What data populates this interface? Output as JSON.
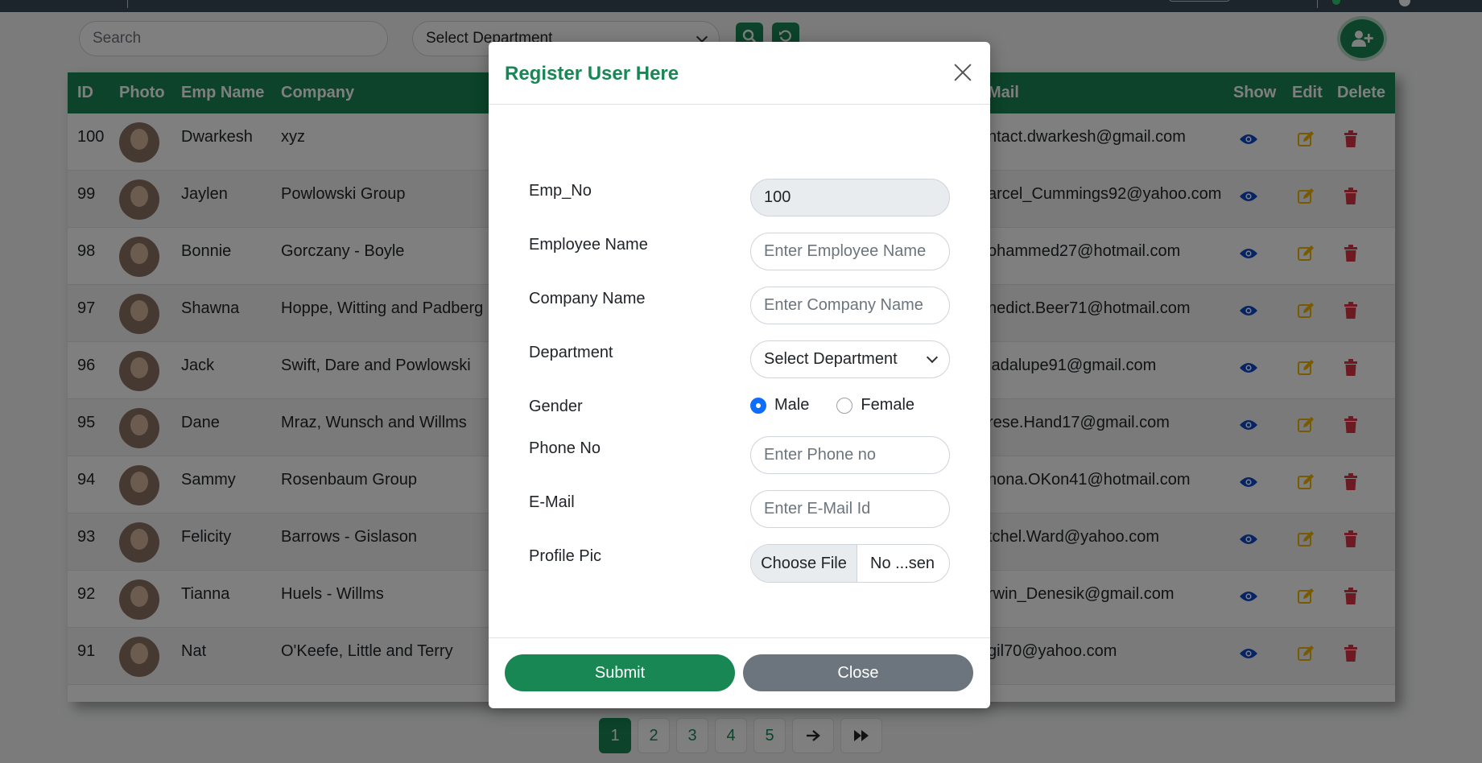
{
  "toolbar": {
    "search_placeholder": "Search",
    "department_select": "Select Department",
    "search_icon": "search-icon",
    "reset_icon": "refresh-icon",
    "add_user_icon": "user-plus-icon"
  },
  "table": {
    "headers": [
      "ID",
      "Photo",
      "Emp Name",
      "Company",
      "Mail",
      "Show",
      "Edit",
      "Delete"
    ],
    "rows": [
      {
        "id": "100",
        "name": "Dwarkesh",
        "company": "xyz",
        "mail": "ntact.dwarkesh@gmail.com"
      },
      {
        "id": "99",
        "name": "Jaylen",
        "company": "Powlowski Group",
        "mail": "arcel_Cummings92@yahoo.com"
      },
      {
        "id": "98",
        "name": "Bonnie",
        "company": "Gorczany - Boyle",
        "mail": "ohammed27@hotmail.com"
      },
      {
        "id": "97",
        "name": "Shawna",
        "company": "Hoppe, Witting and Padberg",
        "mail": "nedict.Beer71@hotmail.com"
      },
      {
        "id": "96",
        "name": "Jack",
        "company": "Swift, Dare and Powlowski",
        "mail": "iadalupe91@gmail.com"
      },
      {
        "id": "95",
        "name": "Dane",
        "company": "Mraz, Wunsch and Willms",
        "mail": "rese.Hand17@gmail.com"
      },
      {
        "id": "94",
        "name": "Sammy",
        "company": "Rosenbaum Group",
        "mail": "nona.OKon41@hotmail.com"
      },
      {
        "id": "93",
        "name": "Felicity",
        "company": "Barrows - Gislason",
        "mail": "tchel.Ward@yahoo.com"
      },
      {
        "id": "92",
        "name": "Tianna",
        "company": "Huels - Willms",
        "mail": "rwin_Denesik@gmail.com"
      },
      {
        "id": "91",
        "name": "Nat",
        "company": "O'Keefe, Little and Terry",
        "mail": "gil70@yahoo.com"
      }
    ],
    "colors": {
      "header": "#198754",
      "show": "#0d47c9",
      "edit": "#f0b400",
      "delete": "#dc3545"
    }
  },
  "pagination": {
    "pages": [
      "1",
      "2",
      "3",
      "4",
      "5"
    ],
    "active": "1",
    "next_icon": "arrow-right-icon",
    "last_icon": "fast-forward-icon"
  },
  "modal": {
    "title": "Register User Here",
    "fields": {
      "emp_no_label": "Emp_No",
      "emp_no_value": "100",
      "employee_name_label": "Employee Name",
      "employee_name_placeholder": "Enter Employee Name",
      "company_name_label": "Company Name",
      "company_name_placeholder": "Enter Company Name",
      "department_label": "Department",
      "department_value": "Select Department",
      "gender_label": "Gender",
      "gender_male": "Male",
      "gender_female": "Female",
      "gender_selected": "Male",
      "phone_label": "Phone No",
      "phone_placeholder": "Enter Phone no",
      "email_label": "E-Mail",
      "email_placeholder": "Enter E-Mail Id",
      "profile_pic_label": "Profile Pic",
      "choose_file": "Choose File",
      "file_name": "No ...sen"
    },
    "submit_label": "Submit",
    "close_label": "Close",
    "accent": "#198754"
  }
}
